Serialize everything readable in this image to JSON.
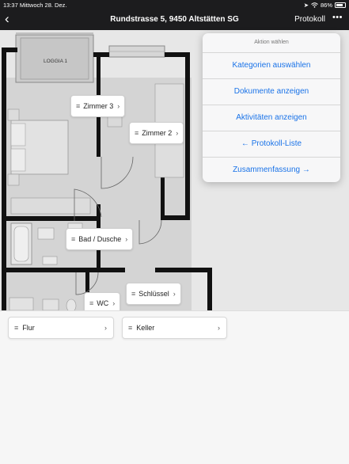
{
  "status_bar": {
    "time_date": "13:37  Mittwoch 28. Dez.",
    "battery": "86%"
  },
  "nav": {
    "back_icon": "‹",
    "title": "Rundstrasse 5, 9450 Altstätten SG",
    "protokoll": "Protokoll",
    "more_icon": "•••"
  },
  "plan": {
    "loggia_label": "LOGGIA 1",
    "rooms": [
      {
        "label": "Zimmer 3"
      },
      {
        "label": "Zimmer 2"
      },
      {
        "label": "Bad / Dusche"
      },
      {
        "label": "Schlüssel"
      },
      {
        "label": "WC"
      }
    ]
  },
  "popover": {
    "header": "Aktion wählen",
    "items": [
      "Kategorien auswählen",
      "Dokumente anzeigen",
      "Aktivitäten anzeigen",
      "← Protokoll-Liste",
      "Zusammenfassung →"
    ]
  },
  "lower": {
    "cards": [
      {
        "label": "Flur"
      },
      {
        "label": "Keller"
      }
    ]
  },
  "icons": {
    "hamburger": "≡",
    "chevron": "›"
  },
  "colors": {
    "accent": "#1a73e8",
    "bar": "#1c1c1e",
    "wall": "#111111"
  }
}
